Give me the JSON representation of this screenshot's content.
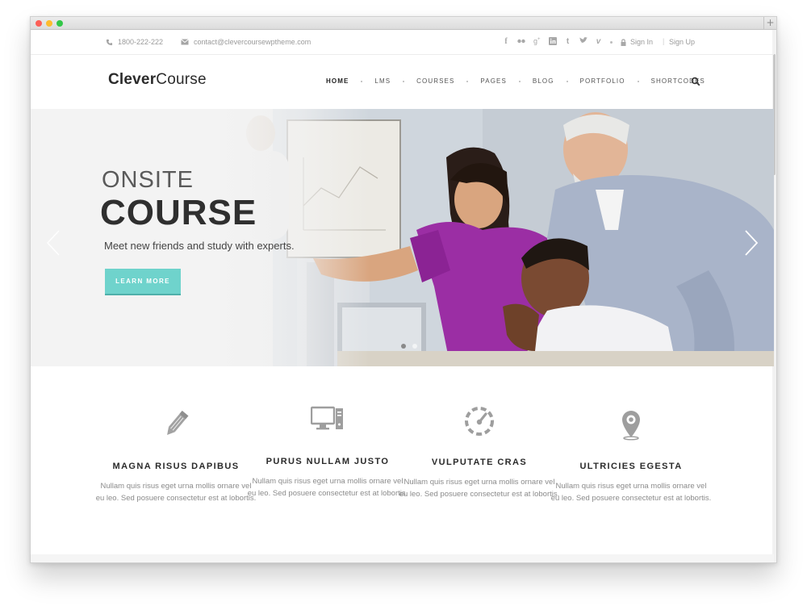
{
  "topbar": {
    "phone": "1800-222-222",
    "email": "contact@clevercoursewptheme.com",
    "social_icons": [
      "facebook-icon",
      "flickr-icon",
      "google-plus-icon",
      "linkedin-icon",
      "tumblr-icon",
      "twitter-icon",
      "vimeo-icon"
    ],
    "sign_in": "Sign In",
    "divider": "|",
    "sign_up": "Sign Up"
  },
  "header": {
    "logo_bold": "Clever",
    "logo_light": "Course",
    "nav": [
      "HOME",
      "LMS",
      "COURSES",
      "PAGES",
      "BLOG",
      "PORTFOLIO",
      "SHORTCODES"
    ],
    "active_nav": "HOME"
  },
  "hero": {
    "title_small": "ONSITE",
    "title_big": "COURSE",
    "subtitle": "Meet new friends and study with experts.",
    "button": "LEARN MORE",
    "slide_count": 2,
    "active_slide": 1
  },
  "features": [
    {
      "icon": "pencil-icon",
      "title": "MAGNA RISUS DAPIBUS",
      "text": "Nullam quis risus eget urna mollis ornare vel eu leo. Sed posuere consectetur est at lobortis."
    },
    {
      "icon": "computer-icon",
      "title": "PURUS NULLAM JUSTO",
      "text": "Nullam quis risus eget urna mollis ornare vel eu leo. Sed posuere consectetur est at lobortis."
    },
    {
      "icon": "speedometer-icon",
      "title": "VULPUTATE CRAS",
      "text": "Nullam quis risus eget urna mollis ornare vel eu leo. Sed posuere consectetur est at lobortis."
    },
    {
      "icon": "map-pin-icon",
      "title": "ULTRICIES EGESTA",
      "text": "Nullam quis risus eget urna mollis ornare vel eu leo. Sed posuere consectetur est at lobortis."
    }
  ],
  "colors": {
    "accent": "#6fd3cc",
    "text_dark": "#2f2f2f",
    "text_muted": "#8b8b8b",
    "icon_gray": "#9e9e9e"
  }
}
